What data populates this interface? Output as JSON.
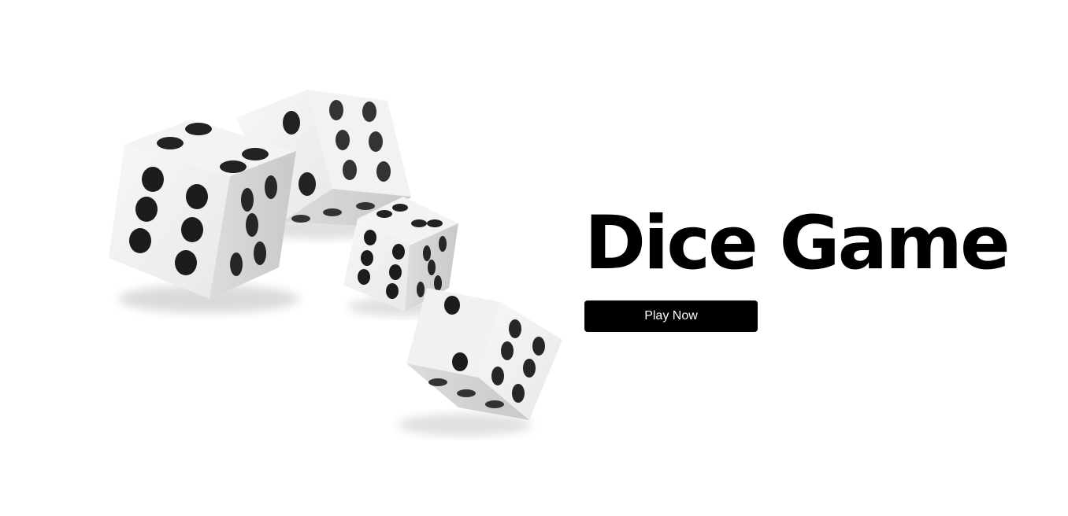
{
  "hero": {
    "title": "Dice Game",
    "play_button_label": "Play Now",
    "image": {
      "icon": "dice-illustration",
      "dice_count": 4
    }
  },
  "colors": {
    "background": "#ffffff",
    "title": "#000000",
    "button_background": "#000000",
    "button_text": "#ffffff",
    "pip": "#222222",
    "die_face_light": "#f4f4f4",
    "die_face_shade": "#d6d6d6"
  }
}
